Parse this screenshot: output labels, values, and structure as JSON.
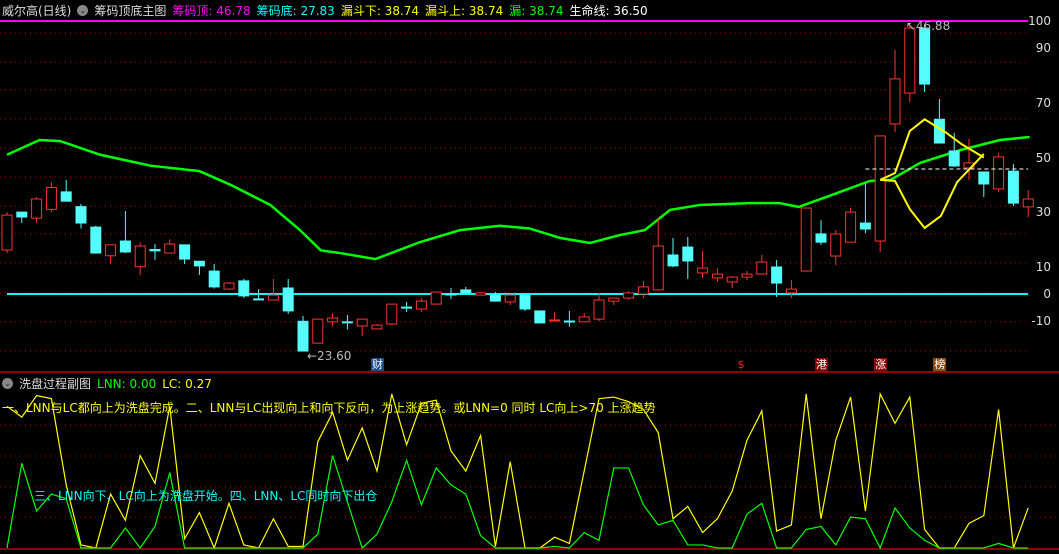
{
  "header": {
    "stock": "威尔高(日线)",
    "indicator": "筹码顶底主图",
    "items": [
      {
        "label": "筹码顶:",
        "value": "46.78",
        "color": "#ff00ff"
      },
      {
        "label": "筹码底:",
        "value": "27.83",
        "color": "#00ffff"
      },
      {
        "label": "漏斗下:",
        "value": "38.74",
        "color": "#ffff00"
      },
      {
        "label": "漏斗上:",
        "value": "38.74",
        "color": "#ffff00"
      },
      {
        "label": "漏:",
        "value": "38.74",
        "color": "#00ff00"
      },
      {
        "label": "生命线:",
        "value": "36.50",
        "color": "#ffffff"
      }
    ]
  },
  "sub_header": {
    "title": "洗盘过程副图",
    "lnn": "LNN: 0.00",
    "lc": "LC: 0.27"
  },
  "notes": {
    "line1": "一、LNN与LC都向上为洗盘完成。二、LNN与LC出现向上和向下反向，为上涨趋势。或LNN=0 同时 LC向上>70 上涨趋势",
    "line2": "三、LNN向下、LC向上为洗盘开始。四、LNN、LC同时向下出仓"
  },
  "labels": {
    "high_price": "46.88",
    "low_price": "23.60"
  },
  "markers": [
    {
      "text": "财",
      "index": 25,
      "bg": "#1a4a8a",
      "fg": "#fff"
    },
    {
      "text": "$",
      "index": 49.7,
      "bg": "transparent",
      "fg": "#ff2020"
    },
    {
      "text": "港",
      "index": 55,
      "bg": "#8a0000",
      "fg": "#fff"
    },
    {
      "text": "涨",
      "index": 59,
      "bg": "#8a0000",
      "fg": "#fff"
    },
    {
      "text": "榜",
      "index": 63,
      "bg": "#8a4a10",
      "fg": "#fff"
    }
  ],
  "colors": {
    "up": "#ff3232",
    "down": "#54fcfc",
    "life": "#00ff00",
    "funnel": "#ffff00",
    "top": "#ff00ff",
    "bottom": "#00ffff",
    "grid": "#a00000"
  },
  "chart_data": [
    {
      "type": "candlestick",
      "title": "筹码顶底主图",
      "yaxis_ticks": [
        "100",
        "90",
        "70",
        "50",
        "30",
        "10",
        "0",
        "-10"
      ],
      "ylim": [
        -13,
        100
      ],
      "candles_ohlc": [
        [
          16.1,
          30,
          15,
          28.9
        ],
        [
          30,
          30,
          26,
          28.2
        ],
        [
          27.8,
          35.5,
          26,
          34.8
        ],
        [
          31,
          41,
          30,
          39
        ],
        [
          37.4,
          41.8,
          34,
          34
        ],
        [
          32,
          33,
          24,
          26
        ],
        [
          24.5,
          25,
          14.8,
          15
        ],
        [
          14,
          18,
          11,
          18
        ],
        [
          19.4,
          30.4,
          15,
          15.4
        ],
        [
          10,
          19,
          7,
          17.6
        ],
        [
          16.3,
          18.3,
          12.5,
          15.8
        ],
        [
          15,
          20,
          15,
          18.3
        ],
        [
          18,
          18,
          11,
          12.8
        ],
        [
          12,
          12,
          7,
          10.3
        ],
        [
          8.4,
          11,
          2,
          2.6
        ],
        [
          1.8,
          4.4,
          1.8,
          4
        ],
        [
          4.8,
          5.5,
          -1.5,
          -0.7
        ],
        [
          -1.8,
          1.8,
          -1.8,
          -1.8
        ],
        [
          -2.2,
          5.5,
          -2.2,
          -0.4
        ],
        [
          2.2,
          5.5,
          -7.3,
          -6.2
        ],
        [
          -10,
          -8,
          -21,
          -20.9
        ],
        [
          -18,
          -9.2,
          -18,
          -9.2
        ],
        [
          -10.2,
          -7,
          -12,
          -8.8
        ],
        [
          -10.2,
          -7.7,
          -13,
          -10.2
        ],
        [
          -11.7,
          -9,
          -15.4,
          -9.2
        ],
        [
          -12.8,
          -11,
          -12.8,
          -11.4
        ],
        [
          -11,
          -3.7,
          -11.4,
          -3.7
        ],
        [
          -4.8,
          -2.9,
          -6.6,
          -4.8
        ],
        [
          -5.5,
          -1.5,
          -6.6,
          -2.6
        ],
        [
          -3.7,
          1,
          -3.7,
          0.7
        ],
        [
          0,
          2.2,
          -1.8,
          0
        ],
        [
          1.5,
          2.6,
          0,
          0.4
        ],
        [
          -0.4,
          0.7,
          -0.4,
          0.4
        ],
        [
          -0.4,
          0.7,
          -2.6,
          -2.6
        ],
        [
          -2.9,
          0,
          -4,
          -0.4
        ],
        [
          -0.4,
          -0.4,
          -6.2,
          -5.5
        ],
        [
          -6.2,
          -6.2,
          -10.6,
          -10.6
        ],
        [
          -9.9,
          -6.6,
          -9.9,
          -9.5
        ],
        [
          -9.9,
          -6.2,
          -12,
          -9.9
        ],
        [
          -10.2,
          -7,
          -10.2,
          -8.4
        ],
        [
          -9.2,
          0.4,
          -10,
          -2.2
        ],
        [
          -2.6,
          -1.5,
          -4,
          -1.5
        ],
        [
          -1.5,
          1.1,
          -2.2,
          0.4
        ],
        [
          0,
          4.8,
          -1.5,
          2.6
        ],
        [
          1.5,
          27.8,
          1.5,
          17.6
        ],
        [
          14.3,
          20.5,
          9.9,
          10.3
        ],
        [
          17.2,
          20.9,
          5.5,
          12.1
        ],
        [
          7.7,
          15.8,
          5.9,
          9.5
        ],
        [
          5.9,
          9.5,
          4.4,
          7.3
        ],
        [
          4.4,
          6.6,
          2.2,
          6.2
        ],
        [
          6.2,
          8.4,
          5.1,
          7.3
        ],
        [
          7.3,
          14.3,
          7.3,
          11.7
        ],
        [
          9.9,
          12.5,
          -1.1,
          4
        ],
        [
          0.4,
          5.1,
          -1.5,
          1.8
        ],
        [
          8.4,
          31.5,
          8.4,
          31.5
        ],
        [
          22,
          27,
          18,
          19
        ],
        [
          13.9,
          23.4,
          10.6,
          22
        ],
        [
          19,
          31.5,
          19,
          30
        ],
        [
          26,
          40.7,
          22.3,
          23.8
        ],
        [
          19.4,
          57.9,
          15.4,
          57.9
        ],
        [
          62.3,
          89.4,
          59.3,
          78.8
        ],
        [
          73.6,
          98.9,
          70.3,
          97.4
        ],
        [
          97.4,
          98.9,
          74,
          76.9
        ],
        [
          64,
          71.4,
          55.3,
          55.3
        ],
        [
          52.4,
          59,
          46.5,
          46.9
        ],
        [
          46.2,
          56.8,
          41.8,
          48
        ],
        [
          44.7,
          44.7,
          35.5,
          40.3
        ],
        [
          38.5,
          51.6,
          37.4,
          50.2
        ],
        [
          45,
          47.6,
          32.2,
          33.3
        ],
        [
          31.9,
          38,
          28.2,
          34.8
        ]
      ],
      "life_line": [
        [
          0,
          51
        ],
        [
          2.2,
          56.4
        ],
        [
          3.6,
          56
        ],
        [
          6.3,
          51
        ],
        [
          9.7,
          47
        ],
        [
          13,
          45
        ],
        [
          15.1,
          40
        ],
        [
          17.8,
          32.6
        ],
        [
          19.8,
          23.4
        ],
        [
          21.2,
          16
        ],
        [
          22.5,
          15
        ],
        [
          24.9,
          12.8
        ],
        [
          27.9,
          19
        ],
        [
          30.6,
          23.4
        ],
        [
          33.3,
          25
        ],
        [
          35.3,
          24
        ],
        [
          37.4,
          20.5
        ],
        [
          39.4,
          18.7
        ],
        [
          41.4,
          21.6
        ],
        [
          43.1,
          23.4
        ],
        [
          44.8,
          30.8
        ],
        [
          46.8,
          32.6
        ],
        [
          50.2,
          33.3
        ],
        [
          52.2,
          33.3
        ],
        [
          53.5,
          31.9
        ],
        [
          55.6,
          36
        ],
        [
          58.3,
          41.4
        ],
        [
          59.7,
          41.8
        ],
        [
          61.7,
          48
        ],
        [
          64.4,
          52.7
        ],
        [
          67.1,
          56.4
        ],
        [
          69.1,
          57.5
        ]
      ],
      "funnel_upper": [
        [
          59,
          41.8
        ],
        [
          60,
          44.3
        ],
        [
          61,
          59.7
        ],
        [
          62,
          64
        ],
        [
          63.4,
          59.3
        ],
        [
          64.5,
          54.9
        ],
        [
          66,
          50
        ]
      ],
      "funnel_lower": [
        [
          59,
          41.8
        ],
        [
          60,
          41.4
        ],
        [
          61,
          31.1
        ],
        [
          62,
          24.2
        ],
        [
          63.1,
          28.6
        ],
        [
          64.2,
          41
        ],
        [
          66,
          51.3
        ]
      ],
      "top_line": 100,
      "bottom_line": 0,
      "dashed_level": {
        "value": 45.8,
        "from": 58,
        "to": 69
      }
    },
    {
      "type": "line",
      "title": "洗盘过程副图",
      "ylim": [
        0,
        100
      ],
      "series": [
        {
          "name": "LNN",
          "color": "#ffff00",
          "values": [
            92,
            85,
            99,
            97,
            41,
            2,
            0,
            35,
            18,
            60,
            42,
            92,
            6,
            23,
            0,
            29,
            2,
            0,
            19,
            1,
            1,
            69,
            88,
            57,
            78,
            50,
            100,
            67,
            94,
            96,
            63,
            50,
            73,
            1,
            56,
            0,
            0,
            7,
            3,
            50,
            97,
            98,
            95,
            90,
            75,
            19,
            27,
            10,
            19,
            37,
            70,
            89,
            11,
            15,
            100,
            19,
            70,
            98,
            24,
            100,
            81,
            98,
            12,
            0,
            0,
            16,
            21,
            90,
            0,
            26
          ]
        },
        {
          "name": "LC",
          "color": "#00ff00",
          "values": [
            0,
            55,
            24,
            35,
            32,
            0,
            0,
            0,
            13,
            0,
            14,
            49,
            0,
            0,
            0,
            0,
            0,
            0,
            0,
            0,
            0,
            9,
            60,
            30,
            0,
            9,
            30,
            57,
            28,
            52,
            41,
            35,
            8,
            0,
            0,
            0,
            0,
            1,
            0,
            10,
            5,
            52,
            52,
            28,
            15,
            18,
            2,
            2,
            0,
            0,
            22,
            29,
            0,
            0,
            12,
            14,
            2,
            20,
            19,
            0,
            26,
            13,
            5,
            0,
            0,
            0,
            0,
            3,
            0,
            0
          ]
        }
      ]
    }
  ]
}
